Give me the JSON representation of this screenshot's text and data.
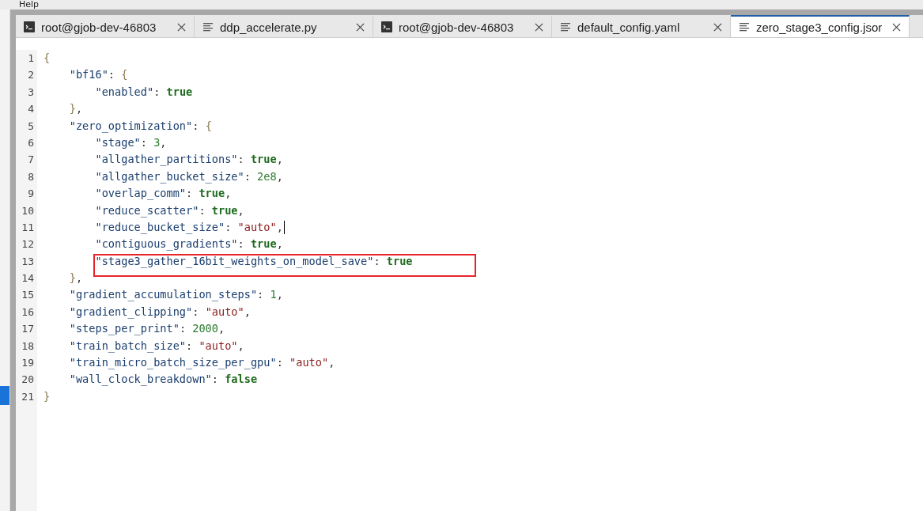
{
  "menu": [
    "Help"
  ],
  "tabs": [
    {
      "label": "root@gjob-dev-46803",
      "kind": "terminal",
      "selected": false
    },
    {
      "label": "ddp_accelerate.py",
      "kind": "file",
      "selected": false
    },
    {
      "label": "root@gjob-dev-46803",
      "kind": "terminal",
      "selected": false
    },
    {
      "label": "default_config.yaml",
      "kind": "file",
      "selected": false
    },
    {
      "label": "zero_stage3_config.jsor",
      "kind": "file",
      "selected": true
    }
  ],
  "lines": [
    {
      "number": "1",
      "highlighted": false,
      "cursor": false,
      "tokens": [
        {
          "kind": "punct",
          "text": "{"
        }
      ]
    },
    {
      "number": "2",
      "highlighted": false,
      "cursor": false,
      "tokens": [
        {
          "kind": "key",
          "text": "    \"bf16\""
        },
        {
          "kind": "plain",
          "text": ": "
        },
        {
          "kind": "punct",
          "text": "{"
        }
      ]
    },
    {
      "number": "3",
      "highlighted": false,
      "cursor": false,
      "tokens": [
        {
          "kind": "key",
          "text": "        \"enabled\""
        },
        {
          "kind": "plain",
          "text": ": "
        },
        {
          "kind": "bool",
          "text": "true"
        }
      ]
    },
    {
      "number": "4",
      "highlighted": false,
      "cursor": false,
      "tokens": [
        {
          "kind": "punct",
          "text": "    }"
        },
        {
          "kind": "plain",
          "text": ","
        }
      ]
    },
    {
      "number": "5",
      "highlighted": false,
      "cursor": false,
      "tokens": [
        {
          "kind": "key",
          "text": "    \"zero_optimization\""
        },
        {
          "kind": "plain",
          "text": ": "
        },
        {
          "kind": "punct",
          "text": "{"
        }
      ]
    },
    {
      "number": "6",
      "highlighted": false,
      "cursor": false,
      "tokens": [
        {
          "kind": "key",
          "text": "        \"stage\""
        },
        {
          "kind": "plain",
          "text": ": "
        },
        {
          "kind": "number",
          "text": "3"
        },
        {
          "kind": "plain",
          "text": ","
        }
      ]
    },
    {
      "number": "7",
      "highlighted": false,
      "cursor": false,
      "tokens": [
        {
          "kind": "key",
          "text": "        \"allgather_partitions\""
        },
        {
          "kind": "plain",
          "text": ": "
        },
        {
          "kind": "bool",
          "text": "true"
        },
        {
          "kind": "plain",
          "text": ","
        }
      ]
    },
    {
      "number": "8",
      "highlighted": false,
      "cursor": false,
      "tokens": [
        {
          "kind": "key",
          "text": "        \"allgather_bucket_size\""
        },
        {
          "kind": "plain",
          "text": ": "
        },
        {
          "kind": "number",
          "text": "2e8"
        },
        {
          "kind": "plain",
          "text": ","
        }
      ]
    },
    {
      "number": "9",
      "highlighted": false,
      "cursor": false,
      "tokens": [
        {
          "kind": "key",
          "text": "        \"overlap_comm\""
        },
        {
          "kind": "plain",
          "text": ": "
        },
        {
          "kind": "bool",
          "text": "true"
        },
        {
          "kind": "plain",
          "text": ","
        }
      ]
    },
    {
      "number": "10",
      "highlighted": false,
      "cursor": false,
      "tokens": [
        {
          "kind": "key",
          "text": "        \"reduce_scatter\""
        },
        {
          "kind": "plain",
          "text": ": "
        },
        {
          "kind": "bool",
          "text": "true"
        },
        {
          "kind": "plain",
          "text": ","
        }
      ]
    },
    {
      "number": "11",
      "highlighted": false,
      "cursor": true,
      "tokens": [
        {
          "kind": "key",
          "text": "        \"reduce_bucket_size\""
        },
        {
          "kind": "plain",
          "text": ": "
        },
        {
          "kind": "string",
          "text": "\"auto\""
        },
        {
          "kind": "plain",
          "text": ","
        }
      ]
    },
    {
      "number": "12",
      "highlighted": false,
      "cursor": false,
      "tokens": [
        {
          "kind": "key",
          "text": "        \"contiguous_gradients\""
        },
        {
          "kind": "plain",
          "text": ": "
        },
        {
          "kind": "bool",
          "text": "true"
        },
        {
          "kind": "plain",
          "text": ","
        }
      ]
    },
    {
      "number": "13",
      "highlighted": true,
      "cursor": false,
      "tokens": [
        {
          "kind": "key",
          "text": "        \"stage3_gather_16bit_weights_on_model_save\""
        },
        {
          "kind": "plain",
          "text": ": "
        },
        {
          "kind": "bool",
          "text": "true"
        }
      ]
    },
    {
      "number": "14",
      "highlighted": false,
      "cursor": false,
      "tokens": [
        {
          "kind": "punct",
          "text": "    }"
        },
        {
          "kind": "plain",
          "text": ","
        }
      ]
    },
    {
      "number": "15",
      "highlighted": false,
      "cursor": false,
      "tokens": [
        {
          "kind": "key",
          "text": "    \"gradient_accumulation_steps\""
        },
        {
          "kind": "plain",
          "text": ": "
        },
        {
          "kind": "number",
          "text": "1"
        },
        {
          "kind": "plain",
          "text": ","
        }
      ]
    },
    {
      "number": "16",
      "highlighted": false,
      "cursor": false,
      "tokens": [
        {
          "kind": "key",
          "text": "    \"gradient_clipping\""
        },
        {
          "kind": "plain",
          "text": ": "
        },
        {
          "kind": "string",
          "text": "\"auto\""
        },
        {
          "kind": "plain",
          "text": ","
        }
      ]
    },
    {
      "number": "17",
      "highlighted": false,
      "cursor": false,
      "tokens": [
        {
          "kind": "key",
          "text": "    \"steps_per_print\""
        },
        {
          "kind": "plain",
          "text": ": "
        },
        {
          "kind": "number",
          "text": "2000"
        },
        {
          "kind": "plain",
          "text": ","
        }
      ]
    },
    {
      "number": "18",
      "highlighted": false,
      "cursor": false,
      "tokens": [
        {
          "kind": "key",
          "text": "    \"train_batch_size\""
        },
        {
          "kind": "plain",
          "text": ": "
        },
        {
          "kind": "string",
          "text": "\"auto\""
        },
        {
          "kind": "plain",
          "text": ","
        }
      ]
    },
    {
      "number": "19",
      "highlighted": false,
      "cursor": false,
      "tokens": [
        {
          "kind": "key",
          "text": "    \"train_micro_batch_size_per_gpu\""
        },
        {
          "kind": "plain",
          "text": ": "
        },
        {
          "kind": "string",
          "text": "\"auto\""
        },
        {
          "kind": "plain",
          "text": ","
        }
      ]
    },
    {
      "number": "20",
      "highlighted": false,
      "cursor": false,
      "tokens": [
        {
          "kind": "key",
          "text": "    \"wall_clock_breakdown\""
        },
        {
          "kind": "plain",
          "text": ": "
        },
        {
          "kind": "bool",
          "text": "false"
        }
      ]
    },
    {
      "number": "21",
      "highlighted": false,
      "cursor": false,
      "tokens": [
        {
          "kind": "punct",
          "text": "}"
        }
      ]
    }
  ]
}
